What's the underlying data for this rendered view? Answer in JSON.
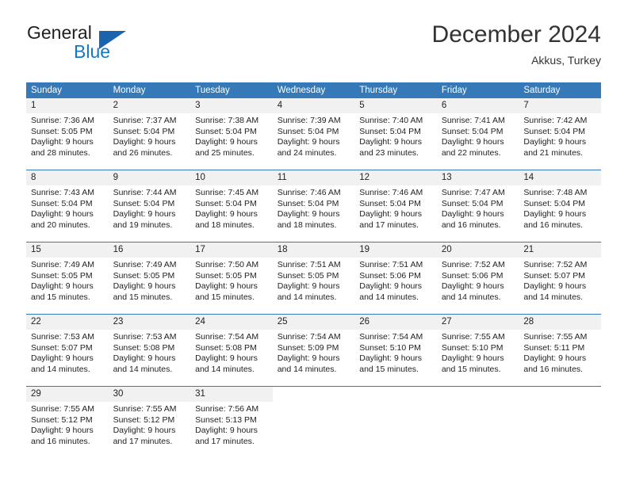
{
  "brand": {
    "name_part1": "General",
    "name_part2": "Blue",
    "triangle_color": "#1b63ac",
    "blue_color": "#1479c4"
  },
  "header": {
    "title": "December 2024",
    "subtitle": "Akkus, Turkey"
  },
  "theme": {
    "header_blue": "#3679b8",
    "daynum_band": "#f1f1f1",
    "text": "#222222"
  },
  "calendar": {
    "weekday_headers": [
      "Sunday",
      "Monday",
      "Tuesday",
      "Wednesday",
      "Thursday",
      "Friday",
      "Saturday"
    ],
    "weeks": [
      [
        {
          "day": "1",
          "sunrise": "Sunrise: 7:36 AM",
          "sunset": "Sunset: 5:05 PM",
          "daylight1": "Daylight: 9 hours",
          "daylight2": "and 28 minutes."
        },
        {
          "day": "2",
          "sunrise": "Sunrise: 7:37 AM",
          "sunset": "Sunset: 5:04 PM",
          "daylight1": "Daylight: 9 hours",
          "daylight2": "and 26 minutes."
        },
        {
          "day": "3",
          "sunrise": "Sunrise: 7:38 AM",
          "sunset": "Sunset: 5:04 PM",
          "daylight1": "Daylight: 9 hours",
          "daylight2": "and 25 minutes."
        },
        {
          "day": "4",
          "sunrise": "Sunrise: 7:39 AM",
          "sunset": "Sunset: 5:04 PM",
          "daylight1": "Daylight: 9 hours",
          "daylight2": "and 24 minutes."
        },
        {
          "day": "5",
          "sunrise": "Sunrise: 7:40 AM",
          "sunset": "Sunset: 5:04 PM",
          "daylight1": "Daylight: 9 hours",
          "daylight2": "and 23 minutes."
        },
        {
          "day": "6",
          "sunrise": "Sunrise: 7:41 AM",
          "sunset": "Sunset: 5:04 PM",
          "daylight1": "Daylight: 9 hours",
          "daylight2": "and 22 minutes."
        },
        {
          "day": "7",
          "sunrise": "Sunrise: 7:42 AM",
          "sunset": "Sunset: 5:04 PM",
          "daylight1": "Daylight: 9 hours",
          "daylight2": "and 21 minutes."
        }
      ],
      [
        {
          "day": "8",
          "sunrise": "Sunrise: 7:43 AM",
          "sunset": "Sunset: 5:04 PM",
          "daylight1": "Daylight: 9 hours",
          "daylight2": "and 20 minutes."
        },
        {
          "day": "9",
          "sunrise": "Sunrise: 7:44 AM",
          "sunset": "Sunset: 5:04 PM",
          "daylight1": "Daylight: 9 hours",
          "daylight2": "and 19 minutes."
        },
        {
          "day": "10",
          "sunrise": "Sunrise: 7:45 AM",
          "sunset": "Sunset: 5:04 PM",
          "daylight1": "Daylight: 9 hours",
          "daylight2": "and 18 minutes."
        },
        {
          "day": "11",
          "sunrise": "Sunrise: 7:46 AM",
          "sunset": "Sunset: 5:04 PM",
          "daylight1": "Daylight: 9 hours",
          "daylight2": "and 18 minutes."
        },
        {
          "day": "12",
          "sunrise": "Sunrise: 7:46 AM",
          "sunset": "Sunset: 5:04 PM",
          "daylight1": "Daylight: 9 hours",
          "daylight2": "and 17 minutes."
        },
        {
          "day": "13",
          "sunrise": "Sunrise: 7:47 AM",
          "sunset": "Sunset: 5:04 PM",
          "daylight1": "Daylight: 9 hours",
          "daylight2": "and 16 minutes."
        },
        {
          "day": "14",
          "sunrise": "Sunrise: 7:48 AM",
          "sunset": "Sunset: 5:04 PM",
          "daylight1": "Daylight: 9 hours",
          "daylight2": "and 16 minutes."
        }
      ],
      [
        {
          "day": "15",
          "sunrise": "Sunrise: 7:49 AM",
          "sunset": "Sunset: 5:05 PM",
          "daylight1": "Daylight: 9 hours",
          "daylight2": "and 15 minutes."
        },
        {
          "day": "16",
          "sunrise": "Sunrise: 7:49 AM",
          "sunset": "Sunset: 5:05 PM",
          "daylight1": "Daylight: 9 hours",
          "daylight2": "and 15 minutes."
        },
        {
          "day": "17",
          "sunrise": "Sunrise: 7:50 AM",
          "sunset": "Sunset: 5:05 PM",
          "daylight1": "Daylight: 9 hours",
          "daylight2": "and 15 minutes."
        },
        {
          "day": "18",
          "sunrise": "Sunrise: 7:51 AM",
          "sunset": "Sunset: 5:05 PM",
          "daylight1": "Daylight: 9 hours",
          "daylight2": "and 14 minutes."
        },
        {
          "day": "19",
          "sunrise": "Sunrise: 7:51 AM",
          "sunset": "Sunset: 5:06 PM",
          "daylight1": "Daylight: 9 hours",
          "daylight2": "and 14 minutes."
        },
        {
          "day": "20",
          "sunrise": "Sunrise: 7:52 AM",
          "sunset": "Sunset: 5:06 PM",
          "daylight1": "Daylight: 9 hours",
          "daylight2": "and 14 minutes."
        },
        {
          "day": "21",
          "sunrise": "Sunrise: 7:52 AM",
          "sunset": "Sunset: 5:07 PM",
          "daylight1": "Daylight: 9 hours",
          "daylight2": "and 14 minutes."
        }
      ],
      [
        {
          "day": "22",
          "sunrise": "Sunrise: 7:53 AM",
          "sunset": "Sunset: 5:07 PM",
          "daylight1": "Daylight: 9 hours",
          "daylight2": "and 14 minutes."
        },
        {
          "day": "23",
          "sunrise": "Sunrise: 7:53 AM",
          "sunset": "Sunset: 5:08 PM",
          "daylight1": "Daylight: 9 hours",
          "daylight2": "and 14 minutes."
        },
        {
          "day": "24",
          "sunrise": "Sunrise: 7:54 AM",
          "sunset": "Sunset: 5:08 PM",
          "daylight1": "Daylight: 9 hours",
          "daylight2": "and 14 minutes."
        },
        {
          "day": "25",
          "sunrise": "Sunrise: 7:54 AM",
          "sunset": "Sunset: 5:09 PM",
          "daylight1": "Daylight: 9 hours",
          "daylight2": "and 14 minutes."
        },
        {
          "day": "26",
          "sunrise": "Sunrise: 7:54 AM",
          "sunset": "Sunset: 5:10 PM",
          "daylight1": "Daylight: 9 hours",
          "daylight2": "and 15 minutes."
        },
        {
          "day": "27",
          "sunrise": "Sunrise: 7:55 AM",
          "sunset": "Sunset: 5:10 PM",
          "daylight1": "Daylight: 9 hours",
          "daylight2": "and 15 minutes."
        },
        {
          "day": "28",
          "sunrise": "Sunrise: 7:55 AM",
          "sunset": "Sunset: 5:11 PM",
          "daylight1": "Daylight: 9 hours",
          "daylight2": "and 16 minutes."
        }
      ],
      [
        {
          "day": "29",
          "sunrise": "Sunrise: 7:55 AM",
          "sunset": "Sunset: 5:12 PM",
          "daylight1": "Daylight: 9 hours",
          "daylight2": "and 16 minutes."
        },
        {
          "day": "30",
          "sunrise": "Sunrise: 7:55 AM",
          "sunset": "Sunset: 5:12 PM",
          "daylight1": "Daylight: 9 hours",
          "daylight2": "and 17 minutes."
        },
        {
          "day": "31",
          "sunrise": "Sunrise: 7:56 AM",
          "sunset": "Sunset: 5:13 PM",
          "daylight1": "Daylight: 9 hours",
          "daylight2": "and 17 minutes."
        },
        {
          "day": "",
          "sunrise": "",
          "sunset": "",
          "daylight1": "",
          "daylight2": ""
        },
        {
          "day": "",
          "sunrise": "",
          "sunset": "",
          "daylight1": "",
          "daylight2": ""
        },
        {
          "day": "",
          "sunrise": "",
          "sunset": "",
          "daylight1": "",
          "daylight2": ""
        },
        {
          "day": "",
          "sunrise": "",
          "sunset": "",
          "daylight1": "",
          "daylight2": ""
        }
      ]
    ]
  }
}
